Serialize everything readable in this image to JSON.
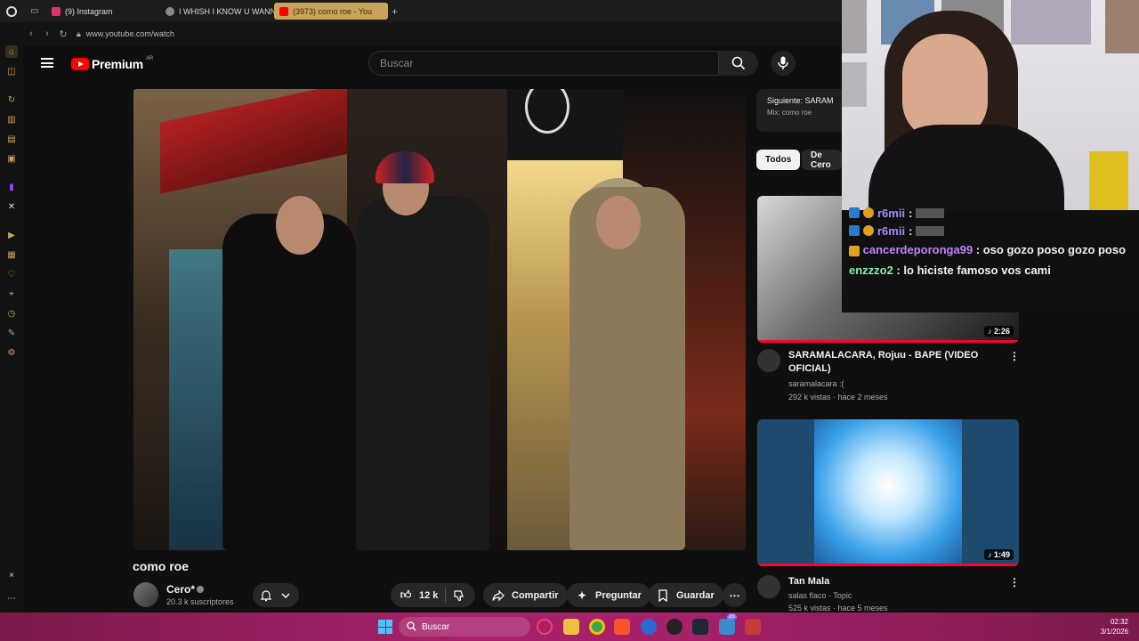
{
  "browser": {
    "tabs": [
      {
        "label": "(9) Instagram",
        "color": "#e1306c"
      },
      {
        "label": "I WHISH I KNOW U WANN",
        "color": "#888888"
      },
      {
        "label": "(3973) como roe - You",
        "color": "#ff0000",
        "active": true
      }
    ],
    "new_tab": "+",
    "url": "www.youtube.com/watch"
  },
  "youtube": {
    "logo_text": "Premium",
    "region": "AR",
    "search_placeholder": "Buscar",
    "video": {
      "title": "como roe",
      "channel": "Cero*",
      "subscribers": "20.3 k suscriptores",
      "likes": "12 k",
      "share_label": "Compartir",
      "ask_label": "Preguntar",
      "save_label": "Guardar"
    },
    "up_next": {
      "heading": "Siguiente: SARAM",
      "subtitle": "Mix: como roe"
    },
    "chips": [
      "Todos",
      "De Cero"
    ],
    "recommendations": [
      {
        "title": "SARAMALACARA, Rojuu - BAPE (VIDEO OFICIAL)",
        "channel": "saramalacara :(",
        "meta": "292 k vistas · hace 2 meses",
        "duration": "2:26"
      },
      {
        "title": "Tan Mala",
        "channel": "salas flaco - Topic",
        "meta": "525 k vistas · hace 5 meses",
        "duration": "1:49"
      }
    ]
  },
  "chat": [
    {
      "user": "r6mii",
      "text": "",
      "user_color": "#a78bfa"
    },
    {
      "user": "r6mii",
      "text": "",
      "user_color": "#a78bfa"
    },
    {
      "user": "cancerdeporonga99",
      "text": ": oso gozo poso gozo poso",
      "user_color": "#c084fc"
    },
    {
      "user": "enzzzo2",
      "text": ": lo hiciste famoso vos cami",
      "user_color": "#86efac"
    }
  ],
  "taskbar": {
    "search_label": "Buscar",
    "time": "02:32",
    "date": "3/1/2026",
    "badge_count": "20"
  }
}
